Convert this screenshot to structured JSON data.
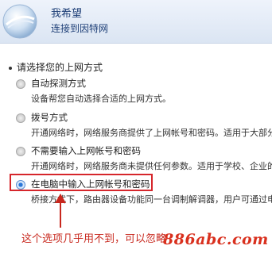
{
  "header": {
    "title": "我希望",
    "subtitle": "连接到因特网"
  },
  "section_title": "请选择您的上网方式",
  "options": [
    {
      "label": "自动探测方式",
      "desc": "设备帮您自动选择合适的上网方式。",
      "selected": false
    },
    {
      "label": "拨号方式",
      "desc": "开通网络时，网络服务商提供了上网帐号和密码。适用于大部分",
      "selected": false
    },
    {
      "label": "不需要输入上网帐号和密码",
      "desc": "开通网络时，网络服务商未提供任何参数。适用于学校、企业的",
      "selected": false
    },
    {
      "label": "在电脑中输入上网帐号和密码",
      "desc": "桥接方式下，路由器设备功能同一台调制解调器，用户可通过电",
      "selected": true
    }
  ],
  "annotation": "这个选项几乎用不到，可以忽略",
  "watermark": "886abc.com",
  "colors": {
    "annotation_red": "#d6262b",
    "radio_selected": "#2b78d8",
    "header_text": "#1e3f77"
  }
}
